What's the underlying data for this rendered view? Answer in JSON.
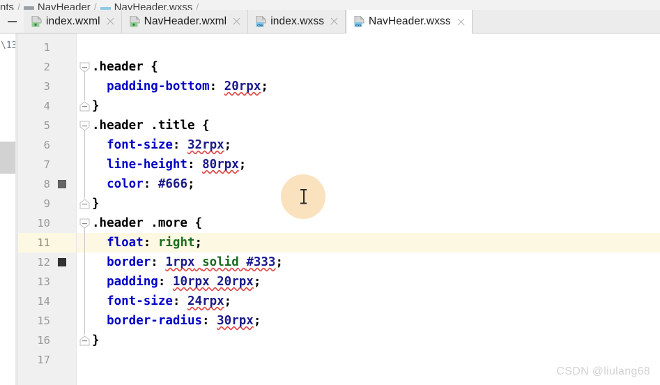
{
  "breadcrumb": {
    "items": [
      {
        "label": "nts",
        "icon": "none"
      },
      {
        "label": "NavHeader",
        "icon": "folder-icon"
      },
      {
        "label": "NavHeader.wxss",
        "icon": "css-file-icon"
      }
    ],
    "separator": "/"
  },
  "tabbar": {
    "collapse_icon": "minimize-icon",
    "close_icon": "close-icon",
    "tabs": [
      {
        "label": "index.wxml",
        "icon": "wxml-file-icon",
        "active": false
      },
      {
        "label": "NavHeader.wxml",
        "icon": "wxml-file-icon",
        "active": false
      },
      {
        "label": "index.wxss",
        "icon": "wxss-file-icon",
        "active": false
      },
      {
        "label": "NavHeader.wxss",
        "icon": "wxss-file-icon",
        "active": true
      }
    ]
  },
  "left_rail": {
    "text": "\\13",
    "scrollbar": "vertical-scrollbar-thumb"
  },
  "editor": {
    "highlighted_line": 11,
    "cursor_overlay": "click-highlight-blob",
    "cursor_icon": "text-ibeam-cursor",
    "color_swatches": [
      {
        "line": 8,
        "color": "#666666"
      },
      {
        "line": 12,
        "color": "#333333"
      }
    ],
    "fold_markers": [
      {
        "line": 2,
        "type": "fold-open-start"
      },
      {
        "line": 4,
        "type": "fold-open-end"
      },
      {
        "line": 5,
        "type": "fold-open-start"
      },
      {
        "line": 9,
        "type": "fold-open-end"
      },
      {
        "line": 10,
        "type": "fold-open-start"
      },
      {
        "line": 16,
        "type": "fold-open-end"
      }
    ],
    "lines": [
      {
        "n": 1,
        "tokens": []
      },
      {
        "n": 2,
        "tokens": [
          {
            "t": ".header ",
            "c": "sel"
          },
          {
            "t": "{",
            "c": "punct"
          }
        ]
      },
      {
        "n": 3,
        "tokens": [
          {
            "t": "  ",
            "c": "plain"
          },
          {
            "t": "padding-bottom",
            "c": "prop"
          },
          {
            "t": ": ",
            "c": "punct"
          },
          {
            "t": "20rpx",
            "c": "val",
            "sq": true
          },
          {
            "t": ";",
            "c": "punct"
          }
        ]
      },
      {
        "n": 4,
        "tokens": [
          {
            "t": "}",
            "c": "punct"
          }
        ]
      },
      {
        "n": 5,
        "tokens": [
          {
            "t": ".header .title ",
            "c": "sel"
          },
          {
            "t": "{",
            "c": "punct"
          }
        ]
      },
      {
        "n": 6,
        "tokens": [
          {
            "t": "  ",
            "c": "plain"
          },
          {
            "t": "font-size",
            "c": "prop"
          },
          {
            "t": ": ",
            "c": "punct"
          },
          {
            "t": "32rpx",
            "c": "val",
            "sq": true
          },
          {
            "t": ";",
            "c": "punct"
          }
        ]
      },
      {
        "n": 7,
        "tokens": [
          {
            "t": "  ",
            "c": "plain"
          },
          {
            "t": "line-height",
            "c": "prop"
          },
          {
            "t": ": ",
            "c": "punct"
          },
          {
            "t": "80rpx",
            "c": "val",
            "sq": true
          },
          {
            "t": ";",
            "c": "punct"
          }
        ]
      },
      {
        "n": 8,
        "tokens": [
          {
            "t": "  ",
            "c": "plain"
          },
          {
            "t": "color",
            "c": "prop"
          },
          {
            "t": ": ",
            "c": "punct"
          },
          {
            "t": "#666",
            "c": "hex"
          },
          {
            "t": ";",
            "c": "punct"
          }
        ]
      },
      {
        "n": 9,
        "tokens": [
          {
            "t": "}",
            "c": "punct"
          }
        ]
      },
      {
        "n": 10,
        "tokens": [
          {
            "t": ".header .more ",
            "c": "sel"
          },
          {
            "t": "{",
            "c": "punct"
          }
        ]
      },
      {
        "n": 11,
        "tokens": [
          {
            "t": "  ",
            "c": "plain"
          },
          {
            "t": "float",
            "c": "prop"
          },
          {
            "t": ": ",
            "c": "punct"
          },
          {
            "t": "right",
            "c": "kw"
          },
          {
            "t": ";",
            "c": "punct"
          }
        ]
      },
      {
        "n": 12,
        "tokens": [
          {
            "t": "  ",
            "c": "plain"
          },
          {
            "t": "border",
            "c": "prop"
          },
          {
            "t": ": ",
            "c": "punct"
          },
          {
            "t": "1rpx",
            "c": "val",
            "sq": true
          },
          {
            "t": " ",
            "c": "plain",
            "sq": true
          },
          {
            "t": "solid",
            "c": "kw",
            "sq": true
          },
          {
            "t": " ",
            "c": "plain",
            "sq": true
          },
          {
            "t": "#333",
            "c": "hex",
            "sq": true
          },
          {
            "t": ";",
            "c": "punct"
          }
        ]
      },
      {
        "n": 13,
        "tokens": [
          {
            "t": "  ",
            "c": "plain"
          },
          {
            "t": "padding",
            "c": "prop"
          },
          {
            "t": ": ",
            "c": "punct"
          },
          {
            "t": "10rpx 20rpx",
            "c": "val",
            "sq": true
          },
          {
            "t": ";",
            "c": "punct"
          }
        ]
      },
      {
        "n": 14,
        "tokens": [
          {
            "t": "  ",
            "c": "plain"
          },
          {
            "t": "font-size",
            "c": "prop"
          },
          {
            "t": ": ",
            "c": "punct"
          },
          {
            "t": "24rpx",
            "c": "val",
            "sq": true
          },
          {
            "t": ";",
            "c": "punct"
          }
        ]
      },
      {
        "n": 15,
        "tokens": [
          {
            "t": "  ",
            "c": "plain"
          },
          {
            "t": "border-radius",
            "c": "prop"
          },
          {
            "t": ": ",
            "c": "punct"
          },
          {
            "t": "30rpx",
            "c": "val",
            "sq": true
          },
          {
            "t": ";",
            "c": "punct"
          }
        ]
      },
      {
        "n": 16,
        "tokens": [
          {
            "t": "}",
            "c": "punct"
          }
        ]
      },
      {
        "n": 17,
        "tokens": []
      }
    ]
  },
  "watermark": {
    "text": "CSDN @liulang68"
  },
  "colors": {
    "property": "#0000c8",
    "value": "#1a1a8c",
    "keyword": "#1a6b20",
    "squiggle": "#e04a4a",
    "line_highlight": "#fdf8e2",
    "swatch_666": "#666666",
    "swatch_333": "#333333",
    "click_blob": "#fae0b8",
    "tab_active_bg": "#ffffff",
    "tab_bg": "#ececec",
    "gutter_bg": "#f0f0f0"
  }
}
